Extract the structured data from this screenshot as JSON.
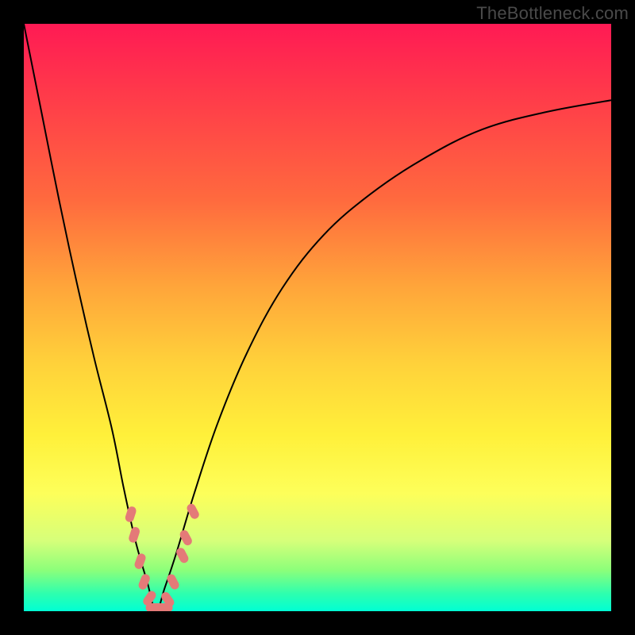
{
  "watermark": "TheBottleneck.com",
  "colors": {
    "frame": "#000000",
    "curve": "#000000",
    "marker": "#e47a78",
    "gradient_top": "#ff1a54",
    "gradient_bottom": "#00ffd4"
  },
  "chart_data": {
    "type": "line",
    "title": "",
    "xlabel": "",
    "ylabel": "",
    "xlim": [
      0,
      100
    ],
    "ylim": [
      0,
      100
    ],
    "grid": false,
    "note": "ylim corresponds to bottleneck percentage; 0 = no bottleneck (green, bottom), 100 = severe bottleneck (red, top). X is an arbitrary component-ratio axis. Curve values estimated from pixel positions.",
    "series": [
      {
        "name": "bottleneck-curve",
        "x": [
          0,
          3,
          6,
          9,
          12,
          15,
          17,
          19,
          21,
          22.5,
          24,
          26,
          29,
          33,
          38,
          44,
          51,
          59,
          68,
          78,
          89,
          100
        ],
        "values": [
          100,
          85,
          70,
          56,
          43,
          31,
          21,
          12,
          5,
          0,
          4,
          10,
          20,
          32,
          44,
          55,
          64,
          71,
          77,
          82,
          85,
          87
        ]
      }
    ],
    "markers": {
      "name": "highlighted-band",
      "shape": "rounded-lozenge",
      "points": [
        {
          "x": 18.2,
          "y": 16.5,
          "angle": -72
        },
        {
          "x": 18.8,
          "y": 13.0,
          "angle": -72
        },
        {
          "x": 19.8,
          "y": 8.5,
          "angle": -70
        },
        {
          "x": 20.5,
          "y": 5.0,
          "angle": -68
        },
        {
          "x": 21.4,
          "y": 2.2,
          "angle": -55
        },
        {
          "x": 22.5,
          "y": 0.6,
          "angle": 0,
          "long": true
        },
        {
          "x": 23.6,
          "y": 0.6,
          "angle": 0,
          "long": true
        },
        {
          "x": 24.5,
          "y": 2.0,
          "angle": 55
        },
        {
          "x": 25.4,
          "y": 5.0,
          "angle": 62
        },
        {
          "x": 27.0,
          "y": 9.5,
          "angle": 62
        },
        {
          "x": 27.6,
          "y": 12.5,
          "angle": 62
        },
        {
          "x": 28.8,
          "y": 17.0,
          "angle": 62
        }
      ]
    }
  }
}
